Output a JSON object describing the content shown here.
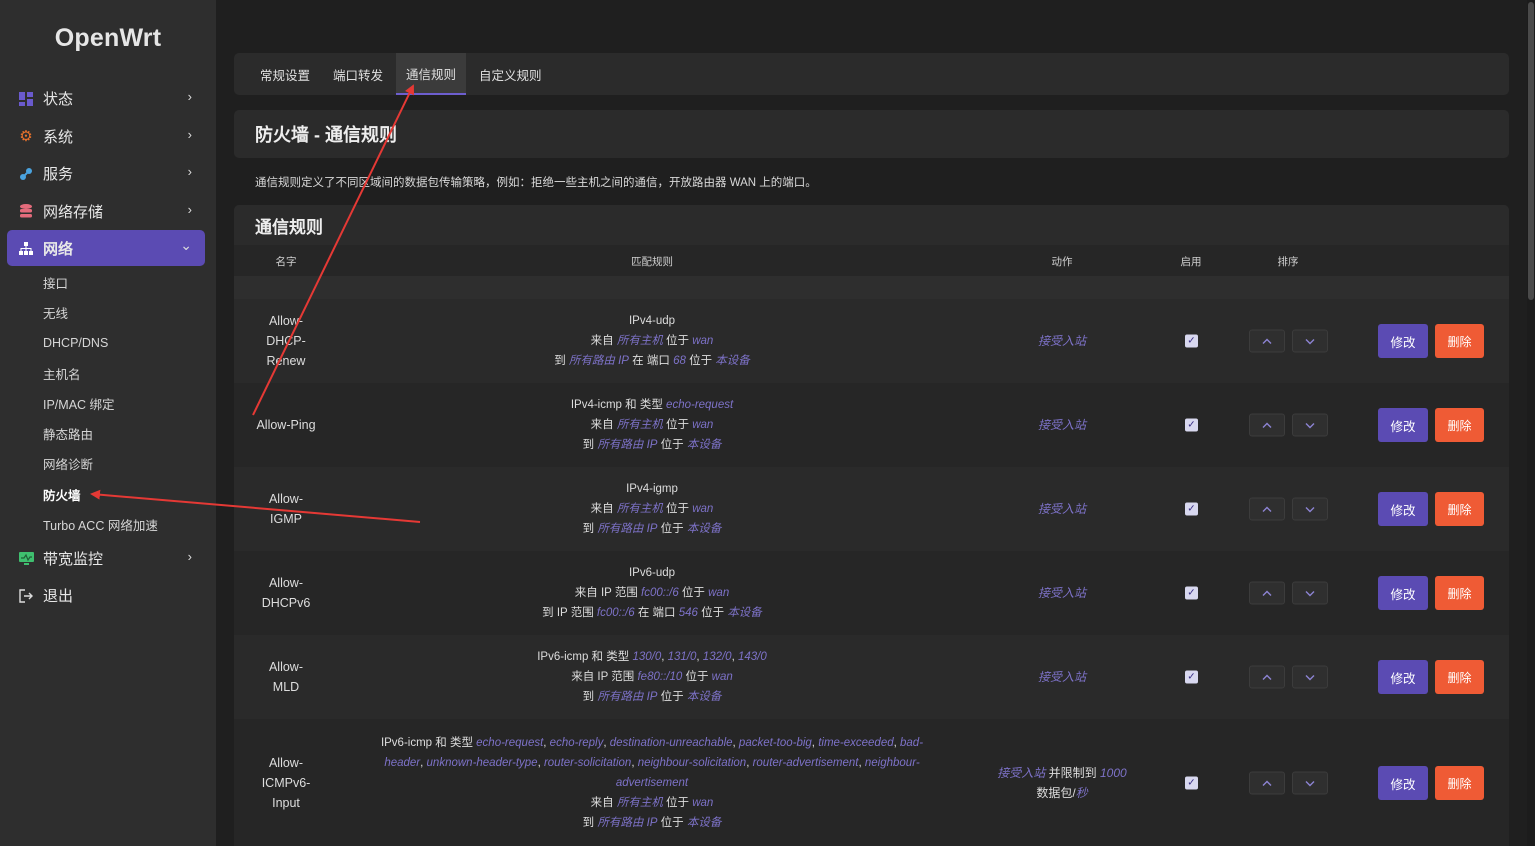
{
  "app": {
    "logo": "OpenWrt"
  },
  "sidebar": {
    "items": [
      {
        "label": "状态",
        "icon": "dashboard-icon",
        "color": "#6a5acd"
      },
      {
        "label": "系统",
        "icon": "gear-icon",
        "color": "#e8722c"
      },
      {
        "label": "服务",
        "icon": "plugin-icon",
        "color": "#4aa3df"
      },
      {
        "label": "网络存储",
        "icon": "database-icon",
        "color": "#e36b7b"
      },
      {
        "label": "网络",
        "icon": "network-icon",
        "color": "#ffffff"
      },
      {
        "label": "带宽监控",
        "icon": "monitor-icon",
        "color": "#3fbf6f"
      },
      {
        "label": "退出",
        "icon": "logout-icon",
        "color": "#dddddd"
      }
    ],
    "network_submenu": [
      "接口",
      "无线",
      "DHCP/DNS",
      "主机名",
      "IP/MAC 绑定",
      "静态路由",
      "网络诊断",
      "防火墙",
      "Turbo ACC 网络加速"
    ]
  },
  "tabs": [
    "常规设置",
    "端口转发",
    "通信规则",
    "自定义规则"
  ],
  "page": {
    "title": "防火墙 - 通信规则",
    "description": "通信规则定义了不同区域间的数据包传输策略，例如：拒绝一些主机之间的通信，开放路由器 WAN 上的端口。",
    "section_title": "通信规则"
  },
  "table": {
    "headers": {
      "name": "名字",
      "match": "匹配规则",
      "action": "动作",
      "enabled": "启用",
      "sort": "排序"
    },
    "edit_label": "修改",
    "delete_label": "删除",
    "rows": [
      {
        "name_lines": [
          "Allow-",
          "DHCP-",
          "Renew"
        ],
        "match": [
          [
            [
              "IPv4-udp",
              ""
            ]
          ],
          [
            [
              "来自 ",
              ""
            ],
            [
              "所有主机",
              "em"
            ],
            [
              " 位于 ",
              ""
            ],
            [
              "wan",
              "em"
            ]
          ],
          [
            [
              "到 ",
              ""
            ],
            [
              "所有路由 IP",
              "em"
            ],
            [
              " 在 端口 ",
              ""
            ],
            [
              "68",
              "em"
            ],
            [
              " 位于 ",
              ""
            ],
            [
              "本设备",
              "em"
            ]
          ]
        ],
        "action": [
          [
            [
              "接受入站",
              "em"
            ]
          ]
        ],
        "enabled": true
      },
      {
        "name_lines": [
          "Allow-Ping"
        ],
        "match": [
          [
            [
              "IPv4-icmp 和 类型 ",
              ""
            ],
            [
              "echo-request",
              "em"
            ]
          ],
          [
            [
              "来自 ",
              ""
            ],
            [
              "所有主机",
              "em"
            ],
            [
              " 位于 ",
              ""
            ],
            [
              "wan",
              "em"
            ]
          ],
          [
            [
              "到 ",
              ""
            ],
            [
              "所有路由 IP",
              "em"
            ],
            [
              " 位于 ",
              ""
            ],
            [
              "本设备",
              "em"
            ]
          ]
        ],
        "action": [
          [
            [
              "接受入站",
              "em"
            ]
          ]
        ],
        "enabled": true
      },
      {
        "name_lines": [
          "Allow-",
          "IGMP"
        ],
        "match": [
          [
            [
              "IPv4-igmp",
              ""
            ]
          ],
          [
            [
              "来自 ",
              ""
            ],
            [
              "所有主机",
              "em"
            ],
            [
              " 位于 ",
              ""
            ],
            [
              "wan",
              "em"
            ]
          ],
          [
            [
              "到 ",
              ""
            ],
            [
              "所有路由 IP",
              "em"
            ],
            [
              " 位于 ",
              ""
            ],
            [
              "本设备",
              "em"
            ]
          ]
        ],
        "action": [
          [
            [
              "接受入站",
              "em"
            ]
          ]
        ],
        "enabled": true
      },
      {
        "name_lines": [
          "Allow-",
          "DHCPv6"
        ],
        "match": [
          [
            [
              "IPv6-udp",
              ""
            ]
          ],
          [
            [
              "来自 IP 范围 ",
              ""
            ],
            [
              "fc00::/6",
              "em"
            ],
            [
              " 位于 ",
              ""
            ],
            [
              "wan",
              "em"
            ]
          ],
          [
            [
              "到 IP 范围 ",
              ""
            ],
            [
              "fc00::/6",
              "em"
            ],
            [
              " 在 端口 ",
              ""
            ],
            [
              "546",
              "em"
            ],
            [
              " 位于 ",
              ""
            ],
            [
              "本设备",
              "em"
            ]
          ]
        ],
        "action": [
          [
            [
              "接受入站",
              "em"
            ]
          ]
        ],
        "enabled": true
      },
      {
        "name_lines": [
          "Allow-",
          "MLD"
        ],
        "match": [
          [
            [
              "IPv6-icmp 和 类型 ",
              ""
            ],
            [
              "130/0",
              "em"
            ],
            [
              ", ",
              ""
            ],
            [
              "131/0",
              "em"
            ],
            [
              ", ",
              ""
            ],
            [
              "132/0",
              "em"
            ],
            [
              ", ",
              ""
            ],
            [
              "143/0",
              "em"
            ]
          ],
          [
            [
              "来自 IP 范围 ",
              ""
            ],
            [
              "fe80::/10",
              "em"
            ],
            [
              " 位于 ",
              ""
            ],
            [
              "wan",
              "em"
            ]
          ],
          [
            [
              "到 ",
              ""
            ],
            [
              "所有路由 IP",
              "em"
            ],
            [
              " 位于 ",
              ""
            ],
            [
              "本设备",
              "em"
            ]
          ]
        ],
        "action": [
          [
            [
              "接受入站",
              "em"
            ]
          ]
        ],
        "enabled": true
      },
      {
        "name_lines": [
          "Allow-",
          "ICMPv6-",
          "Input"
        ],
        "match": [
          [
            [
              "IPv6-icmp 和 类型 ",
              ""
            ],
            [
              "echo-request",
              "em"
            ],
            [
              ", ",
              ""
            ],
            [
              "echo-reply",
              "em"
            ],
            [
              ", ",
              ""
            ],
            [
              "destination-unreachable",
              "em"
            ],
            [
              ", ",
              ""
            ],
            [
              "packet-too-big",
              "em"
            ],
            [
              ", ",
              ""
            ],
            [
              "time-exceeded",
              "em"
            ],
            [
              ", ",
              ""
            ],
            [
              "bad-",
              "em"
            ]
          ],
          [
            [
              "header",
              "em"
            ],
            [
              ", ",
              ""
            ],
            [
              "unknown-header-type",
              "em"
            ],
            [
              ", ",
              ""
            ],
            [
              "router-solicitation",
              "em"
            ],
            [
              ", ",
              ""
            ],
            [
              "neighbour-solicitation",
              "em"
            ],
            [
              ", ",
              ""
            ],
            [
              "router-advertisement",
              "em"
            ],
            [
              ", ",
              ""
            ],
            [
              "neighbour-",
              "em"
            ]
          ],
          [
            [
              "advertisement",
              "em"
            ]
          ],
          [
            [
              "来自 ",
              ""
            ],
            [
              "所有主机",
              "em"
            ],
            [
              " 位于 ",
              ""
            ],
            [
              "wan",
              "em"
            ]
          ],
          [
            [
              "到 ",
              ""
            ],
            [
              "所有路由 IP",
              "em"
            ],
            [
              " 位于 ",
              ""
            ],
            [
              "本设备",
              "em"
            ]
          ]
        ],
        "action": [
          [
            [
              "接受入站",
              "em"
            ],
            [
              " 并限制到 ",
              ""
            ],
            [
              "1000",
              "em"
            ]
          ],
          [
            [
              "数据包/",
              ""
            ],
            [
              "秒",
              "em"
            ]
          ]
        ],
        "enabled": true,
        "tall": true
      }
    ]
  },
  "colors": {
    "accent": "#5b4bb3",
    "danger": "#ef5b35",
    "annotation": "#e53935"
  }
}
